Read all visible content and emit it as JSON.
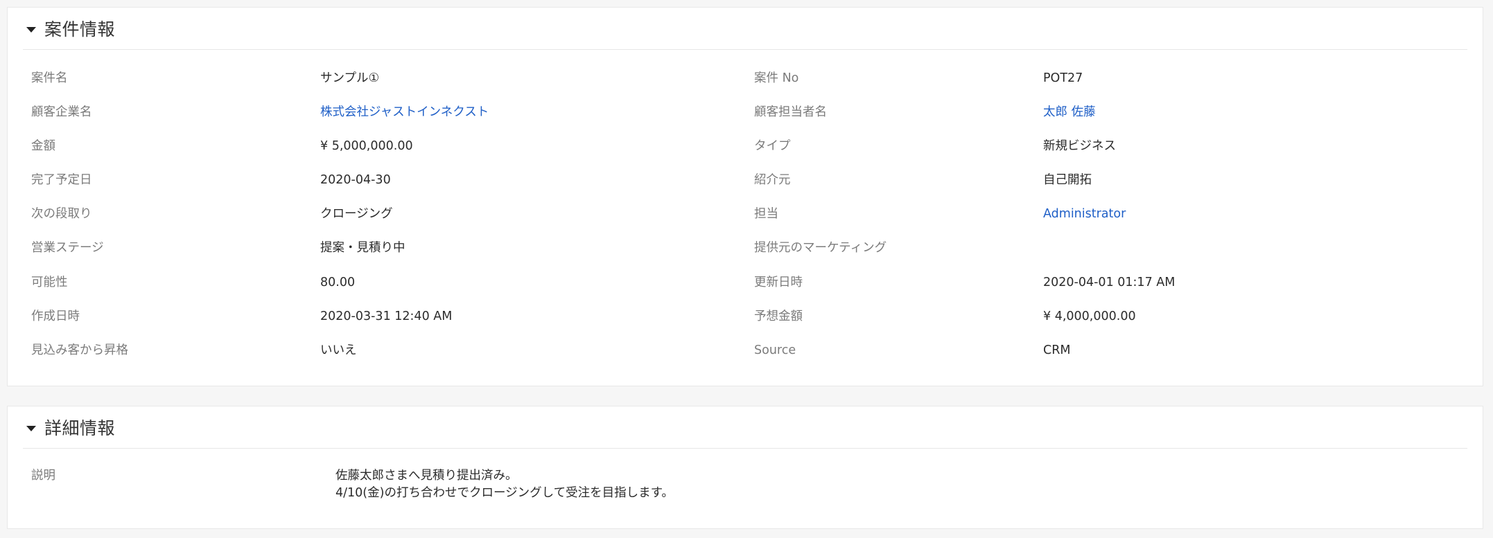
{
  "opportunity_section": {
    "title": "案件情報",
    "fields": {
      "opportunity_name": {
        "label": "案件名",
        "value": "サンプル①"
      },
      "opportunity_no": {
        "label": "案件 No",
        "value": "POT27"
      },
      "account_name": {
        "label": "顧客企業名",
        "value": "株式会社ジャストインネクスト"
      },
      "contact_name": {
        "label": "顧客担当者名",
        "value": "太郎 佐藤"
      },
      "amount": {
        "label": "金額",
        "value": "¥ 5,000,000.00"
      },
      "type": {
        "label": "タイプ",
        "value": "新規ビジネス"
      },
      "expected_close_date": {
        "label": "完了予定日",
        "value": "2020-04-30"
      },
      "lead_source": {
        "label": "紹介元",
        "value": "自己開拓"
      },
      "next_step": {
        "label": "次の段取り",
        "value": "クロージング"
      },
      "assigned_to": {
        "label": "担当",
        "value": "Administrator"
      },
      "sales_stage": {
        "label": "営業ステージ",
        "value": "提案・見積り中"
      },
      "campaign_source": {
        "label": "提供元のマーケティング",
        "value": ""
      },
      "probability": {
        "label": "可能性",
        "value": "80.00"
      },
      "modified_time": {
        "label": "更新日時",
        "value": "2020-04-01 01:17 AM"
      },
      "created_time": {
        "label": "作成日時",
        "value": "2020-03-31 12:40 AM"
      },
      "forecast_amount": {
        "label": "予想金額",
        "value": "¥ 4,000,000.00"
      },
      "converted_from_lead": {
        "label": "見込み客から昇格",
        "value": "いいえ"
      },
      "source": {
        "label": "Source",
        "value": "CRM"
      }
    }
  },
  "detail_section": {
    "title": "詳細情報",
    "description": {
      "label": "説明",
      "lines": [
        "佐藤太郎さまへ見積り提出済み。",
        "4/10(金)の打ち合わせでクロージングして受注を目指します。"
      ]
    }
  },
  "colors": {
    "link": "#1f5fc7",
    "label": "#7b7b7b",
    "value": "#2b2b2b",
    "background": "#f6f6f6"
  }
}
